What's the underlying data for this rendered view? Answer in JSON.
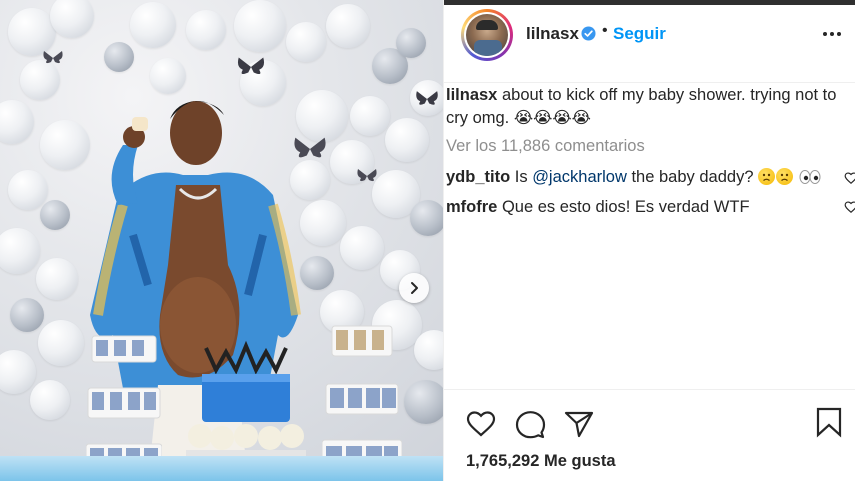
{
  "post": {
    "username": "lilnasx",
    "follow_label": "Seguir",
    "caption_username": "lilnasx",
    "caption_text": "about to kick off my baby shower. trying not to cry omg. 😭😭😭😭",
    "view_comments": "Ver los 11,886 comentarios",
    "comments": [
      {
        "username": "ydb_tito",
        "pre": "Is ",
        "mention": "@jackharlow",
        "post": " the baby daddy?"
      },
      {
        "username": "mfofre",
        "text": "Que es esto dios! Es verdad WTF"
      }
    ],
    "likes": "1,765,292 Me gusta"
  },
  "icons": {
    "verified": "verified-badge-icon",
    "more": "more-options-icon",
    "like": "heart-icon",
    "comment": "comment-bubble-icon",
    "share": "paper-plane-icon",
    "save": "bookmark-icon",
    "next": "chevron-right-icon"
  },
  "colors": {
    "link_blue": "#0095f6",
    "text": "#262626",
    "muted": "#8e8e8e",
    "mention": "#00376b"
  }
}
